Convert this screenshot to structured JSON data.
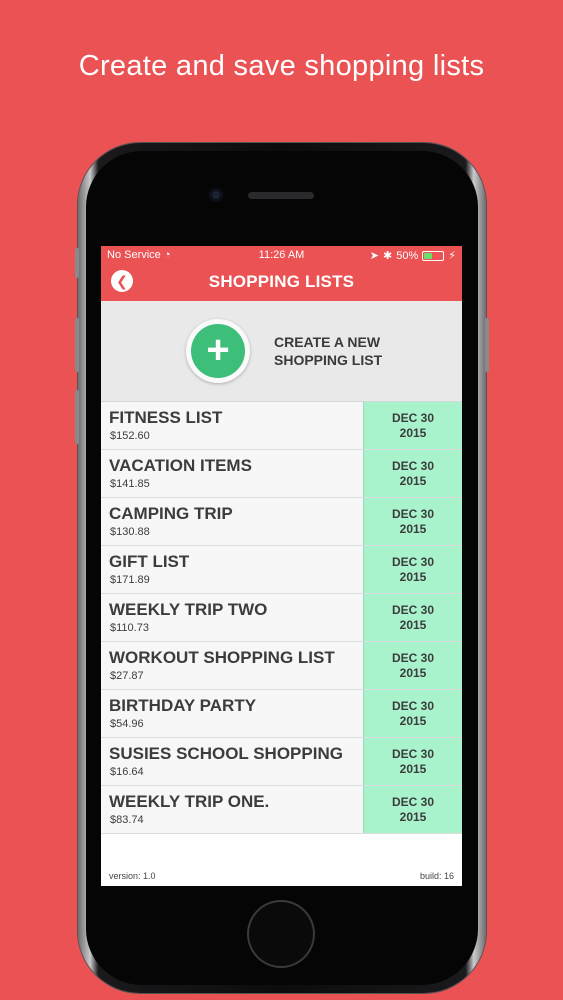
{
  "headline": "Create and save shopping lists",
  "colors": {
    "background": "#ea5254",
    "accent": "#ea5254",
    "create_button": "#3dbf7a",
    "date_cell": "#a8f2cc"
  },
  "status_bar": {
    "carrier": "No Service",
    "time": "11:26 AM",
    "battery": "50%",
    "battery_level": 0.5,
    "icons": [
      "wifi-icon",
      "location-icon",
      "bluetooth-icon",
      "battery-icon",
      "charging-icon"
    ]
  },
  "nav": {
    "title": "SHOPPING LISTS",
    "back_icon": "chevron-left-icon"
  },
  "create": {
    "label_line1": "CREATE A NEW",
    "label_line2": "SHOPPING LIST",
    "icon": "plus-icon"
  },
  "lists": [
    {
      "title": "FITNESS LIST",
      "price": "$152.60",
      "date_month": "DEC 30",
      "date_year": "2015"
    },
    {
      "title": "VACATION ITEMS",
      "price": "$141.85",
      "date_month": "DEC 30",
      "date_year": "2015"
    },
    {
      "title": "CAMPING TRIP",
      "price": "$130.88",
      "date_month": "DEC 30",
      "date_year": "2015"
    },
    {
      "title": "GIFT LIST",
      "price": "$171.89",
      "date_month": "DEC 30",
      "date_year": "2015"
    },
    {
      "title": "WEEKLY TRIP TWO",
      "price": "$110.73",
      "date_month": "DEC 30",
      "date_year": "2015"
    },
    {
      "title": "WORKOUT SHOPPING LIST",
      "price": "$27.87",
      "date_month": "DEC 30",
      "date_year": "2015"
    },
    {
      "title": "BIRTHDAY PARTY",
      "price": "$54.96",
      "date_month": "DEC 30",
      "date_year": "2015"
    },
    {
      "title": "SUSIES SCHOOL SHOPPING",
      "price": "$16.64",
      "date_month": "DEC 30",
      "date_year": "2015"
    },
    {
      "title": "WEEKLY TRIP ONE.",
      "price": "$83.74",
      "date_month": "DEC 30",
      "date_year": "2015"
    }
  ],
  "footer": {
    "version": "version: 1.0",
    "build": "build: 16"
  }
}
